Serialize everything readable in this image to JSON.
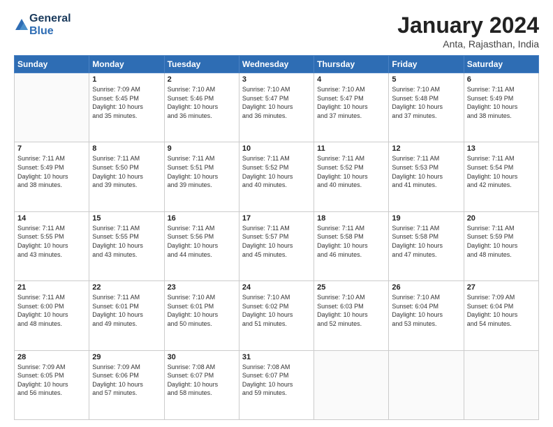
{
  "logo": {
    "line1": "General",
    "line2": "Blue"
  },
  "header": {
    "month": "January 2024",
    "location": "Anta, Rajasthan, India"
  },
  "weekdays": [
    "Sunday",
    "Monday",
    "Tuesday",
    "Wednesday",
    "Thursday",
    "Friday",
    "Saturday"
  ],
  "weeks": [
    [
      {
        "day": "",
        "info": ""
      },
      {
        "day": "1",
        "info": "Sunrise: 7:09 AM\nSunset: 5:45 PM\nDaylight: 10 hours\nand 35 minutes."
      },
      {
        "day": "2",
        "info": "Sunrise: 7:10 AM\nSunset: 5:46 PM\nDaylight: 10 hours\nand 36 minutes."
      },
      {
        "day": "3",
        "info": "Sunrise: 7:10 AM\nSunset: 5:47 PM\nDaylight: 10 hours\nand 36 minutes."
      },
      {
        "day": "4",
        "info": "Sunrise: 7:10 AM\nSunset: 5:47 PM\nDaylight: 10 hours\nand 37 minutes."
      },
      {
        "day": "5",
        "info": "Sunrise: 7:10 AM\nSunset: 5:48 PM\nDaylight: 10 hours\nand 37 minutes."
      },
      {
        "day": "6",
        "info": "Sunrise: 7:11 AM\nSunset: 5:49 PM\nDaylight: 10 hours\nand 38 minutes."
      }
    ],
    [
      {
        "day": "7",
        "info": "Sunrise: 7:11 AM\nSunset: 5:49 PM\nDaylight: 10 hours\nand 38 minutes."
      },
      {
        "day": "8",
        "info": "Sunrise: 7:11 AM\nSunset: 5:50 PM\nDaylight: 10 hours\nand 39 minutes."
      },
      {
        "day": "9",
        "info": "Sunrise: 7:11 AM\nSunset: 5:51 PM\nDaylight: 10 hours\nand 39 minutes."
      },
      {
        "day": "10",
        "info": "Sunrise: 7:11 AM\nSunset: 5:52 PM\nDaylight: 10 hours\nand 40 minutes."
      },
      {
        "day": "11",
        "info": "Sunrise: 7:11 AM\nSunset: 5:52 PM\nDaylight: 10 hours\nand 40 minutes."
      },
      {
        "day": "12",
        "info": "Sunrise: 7:11 AM\nSunset: 5:53 PM\nDaylight: 10 hours\nand 41 minutes."
      },
      {
        "day": "13",
        "info": "Sunrise: 7:11 AM\nSunset: 5:54 PM\nDaylight: 10 hours\nand 42 minutes."
      }
    ],
    [
      {
        "day": "14",
        "info": "Sunrise: 7:11 AM\nSunset: 5:55 PM\nDaylight: 10 hours\nand 43 minutes."
      },
      {
        "day": "15",
        "info": "Sunrise: 7:11 AM\nSunset: 5:55 PM\nDaylight: 10 hours\nand 43 minutes."
      },
      {
        "day": "16",
        "info": "Sunrise: 7:11 AM\nSunset: 5:56 PM\nDaylight: 10 hours\nand 44 minutes."
      },
      {
        "day": "17",
        "info": "Sunrise: 7:11 AM\nSunset: 5:57 PM\nDaylight: 10 hours\nand 45 minutes."
      },
      {
        "day": "18",
        "info": "Sunrise: 7:11 AM\nSunset: 5:58 PM\nDaylight: 10 hours\nand 46 minutes."
      },
      {
        "day": "19",
        "info": "Sunrise: 7:11 AM\nSunset: 5:58 PM\nDaylight: 10 hours\nand 47 minutes."
      },
      {
        "day": "20",
        "info": "Sunrise: 7:11 AM\nSunset: 5:59 PM\nDaylight: 10 hours\nand 48 minutes."
      }
    ],
    [
      {
        "day": "21",
        "info": "Sunrise: 7:11 AM\nSunset: 6:00 PM\nDaylight: 10 hours\nand 48 minutes."
      },
      {
        "day": "22",
        "info": "Sunrise: 7:11 AM\nSunset: 6:01 PM\nDaylight: 10 hours\nand 49 minutes."
      },
      {
        "day": "23",
        "info": "Sunrise: 7:10 AM\nSunset: 6:01 PM\nDaylight: 10 hours\nand 50 minutes."
      },
      {
        "day": "24",
        "info": "Sunrise: 7:10 AM\nSunset: 6:02 PM\nDaylight: 10 hours\nand 51 minutes."
      },
      {
        "day": "25",
        "info": "Sunrise: 7:10 AM\nSunset: 6:03 PM\nDaylight: 10 hours\nand 52 minutes."
      },
      {
        "day": "26",
        "info": "Sunrise: 7:10 AM\nSunset: 6:04 PM\nDaylight: 10 hours\nand 53 minutes."
      },
      {
        "day": "27",
        "info": "Sunrise: 7:09 AM\nSunset: 6:04 PM\nDaylight: 10 hours\nand 54 minutes."
      }
    ],
    [
      {
        "day": "28",
        "info": "Sunrise: 7:09 AM\nSunset: 6:05 PM\nDaylight: 10 hours\nand 56 minutes."
      },
      {
        "day": "29",
        "info": "Sunrise: 7:09 AM\nSunset: 6:06 PM\nDaylight: 10 hours\nand 57 minutes."
      },
      {
        "day": "30",
        "info": "Sunrise: 7:08 AM\nSunset: 6:07 PM\nDaylight: 10 hours\nand 58 minutes."
      },
      {
        "day": "31",
        "info": "Sunrise: 7:08 AM\nSunset: 6:07 PM\nDaylight: 10 hours\nand 59 minutes."
      },
      {
        "day": "",
        "info": ""
      },
      {
        "day": "",
        "info": ""
      },
      {
        "day": "",
        "info": ""
      }
    ]
  ]
}
